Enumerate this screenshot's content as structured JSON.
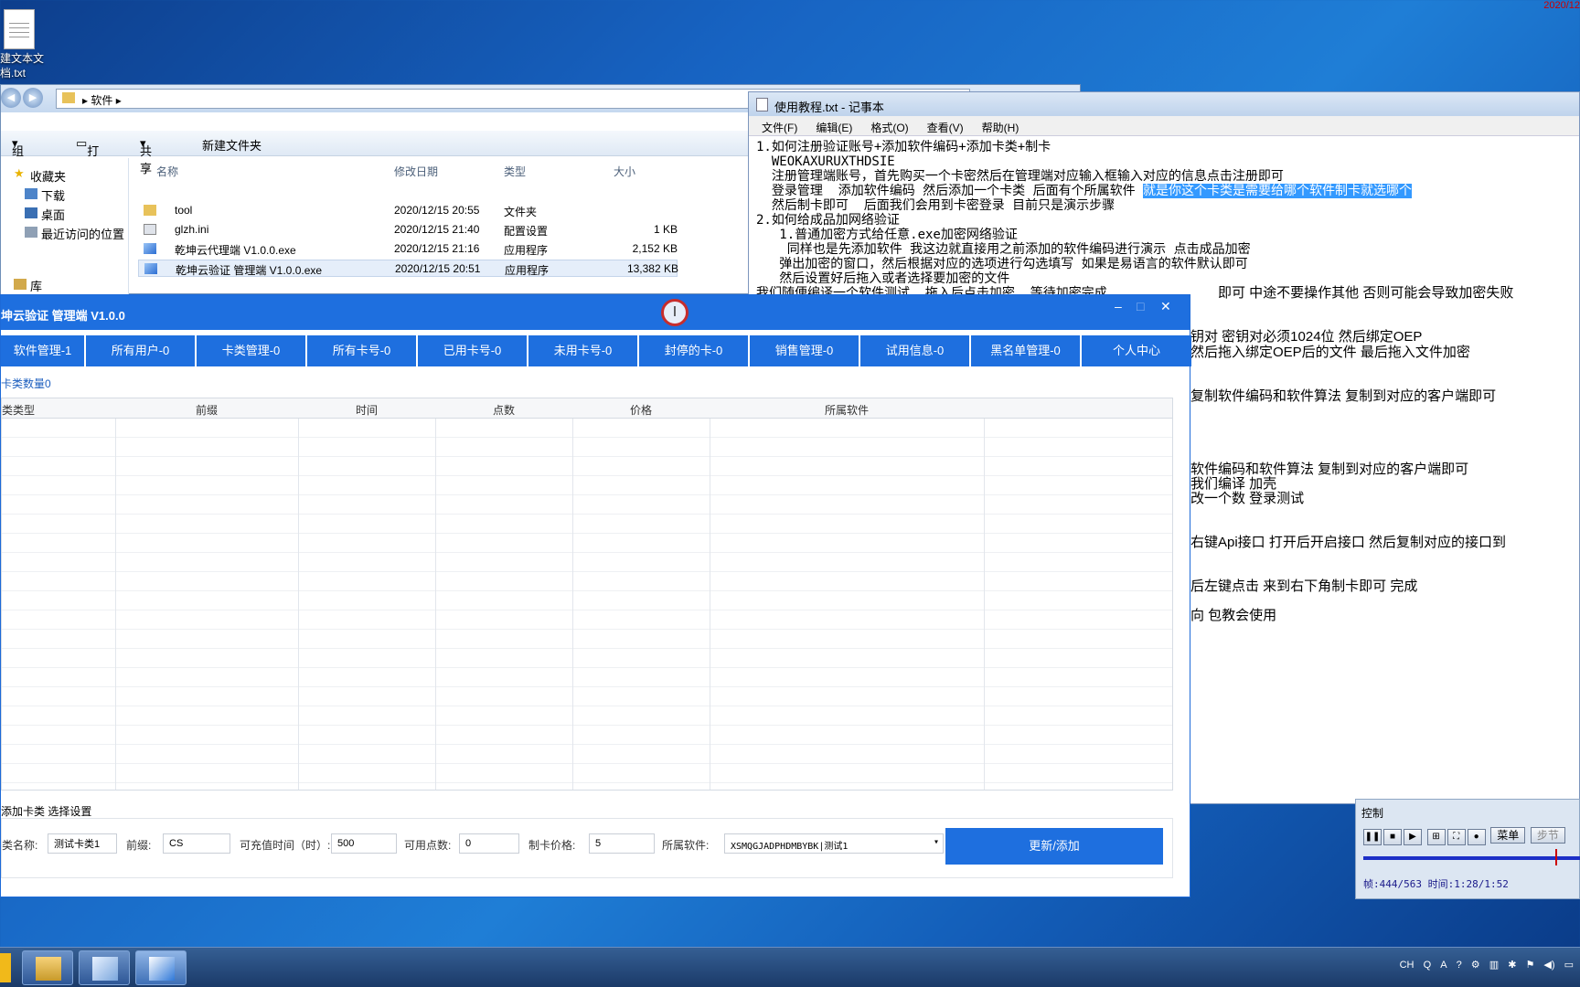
{
  "desktop": {
    "clock_partial": "2020/12",
    "file_label_1": "建文本文",
    "file_label_2": "档.txt"
  },
  "explorer": {
    "path": "软件",
    "toolbar": {
      "organize": "组织",
      "open": "打开",
      "share": "共享",
      "new_folder": "新建文件夹"
    },
    "sidebar": {
      "favorites": "收藏夹",
      "downloads": "下载",
      "desktop": "桌面",
      "recent": "最近访问的位置",
      "library": "库"
    },
    "columns": {
      "name": "名称",
      "date": "修改日期",
      "type": "类型",
      "size": "大小"
    },
    "files": [
      {
        "name": "tool",
        "date": "2020/12/15 20:55",
        "type": "文件夹",
        "size": ""
      },
      {
        "name": "glzh.ini",
        "date": "2020/12/15 21:40",
        "type": "配置设置",
        "size": "1 KB"
      },
      {
        "name": "乾坤云代理端 V1.0.0.exe",
        "date": "2020/12/15 21:16",
        "type": "应用程序",
        "size": "2,152 KB"
      },
      {
        "name": "乾坤云验证 管理端 V1.0.0.exe",
        "date": "2020/12/15 20:51",
        "type": "应用程序",
        "size": "13,382 KB"
      }
    ]
  },
  "notepad": {
    "title": "使用教程.txt - 记事本",
    "menu": [
      "文件(F)",
      "编辑(E)",
      "格式(O)",
      "查看(V)",
      "帮助(H)"
    ],
    "lines": [
      "1.如何注册验证账号+添加软件编码+添加卡类+制卡",
      "  WEOKAXURUXTHDSIE",
      "  注册管理端账号，首先购买一个卡密然后在管理端对应输入框输入对应的信息点击注册即可",
      "  登录管理  添加软件编码 然后添加一个卡类 后面有个所属软件 ",
      "  然后制卡即可  后面我们会用到卡密登录 目前只是演示步骤",
      "2.如何给成品加网络验证",
      "   1.普通加密方式给任意.exe加密网络验证",
      "    同样也是先添加软件 我这边就直接用之前添加的软件编码进行演示 点击成品加密",
      "   弹出加密的窗口，然后根据对应的选项进行勾选填写 如果是易语言的软件默认即可",
      "   然后设置好后拖入或者选择要加密的文件"
    ],
    "highlight": "就是你这个卡类是需要给哪个软件制卡就选哪个",
    "visible_right": [
      "即可 中途不要操作其他 否则可能会导致加密失败",
      "钥对 密钥对必须1024位 然后绑定OEP",
      "然后拖入绑定OEP后的文件 最后拖入文件加密",
      "复制软件编码和软件算法 复制到对应的客户端即可",
      "软件编码和软件算法 复制到对应的客户端即可",
      "我们编译 加壳",
      "改一个数  登录测试",
      "右键Api接口  打开后开启接口 然后复制对应的接口到",
      "后左键点击 来到右下角制卡即可 完成",
      "向 包教会使用"
    ],
    "partial_line": "我们随便编译一个软件测试  拖入后点击加密  等待加密完成"
  },
  "app": {
    "title": "坤云验证 管理端 V1.0.0",
    "window_controls": {
      "minimize": "–",
      "maximize": "□",
      "close": "✕"
    },
    "cursor_glyph": "I",
    "tabs": [
      "软件管理-1",
      "所有用户-0",
      "卡类管理-0",
      "所有卡号-0",
      "已用卡号-0",
      "未用卡号-0",
      "封停的卡-0",
      "销售管理-0",
      "试用信息-0",
      "黑名单管理-0",
      "个人中心"
    ],
    "count_label": "卡类数量0",
    "columns": [
      "类类型",
      "前缀",
      "时间",
      "点数",
      "价格",
      "所属软件"
    ],
    "form": {
      "title": "添加卡类 选择设置",
      "name_label": "类名称:",
      "name_value": "测试卡类1",
      "prefix_label": "前缀:",
      "prefix_value": "CS",
      "hours_label": "可充值时间（时）:",
      "hours_value": "500",
      "points_label": "可用点数:",
      "points_value": "0",
      "price_label": "制卡价格:",
      "price_value": "5",
      "software_label": "所属软件:",
      "software_value": "XSMQGJADPHDMBYBK|测试1",
      "submit": "更新/添加"
    }
  },
  "control_panel": {
    "title": "控制",
    "menu_label": "菜单",
    "step_label": "步节",
    "status": "帧:444/563 时间:1:28/1:52"
  },
  "taskbar": {
    "tray": [
      "CH",
      "Q",
      "A",
      "?",
      "⚙"
    ]
  }
}
